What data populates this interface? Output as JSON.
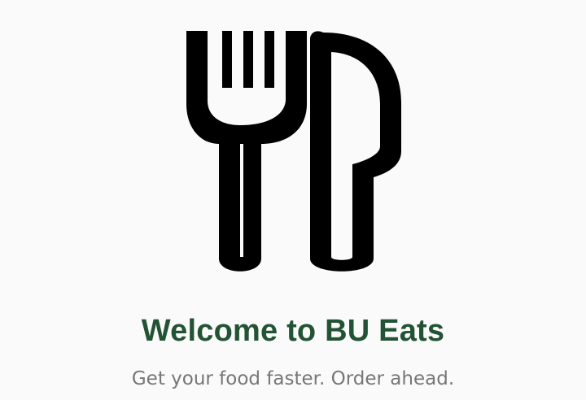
{
  "welcome": {
    "logo_icon": "fork-knife-icon",
    "title": "Welcome to BU Eats",
    "subtitle": "Get your food faster. Order ahead."
  },
  "colors": {
    "brand_green": "#235335",
    "subtitle_gray": "#777777",
    "background": "#fafafa",
    "icon": "#000000"
  }
}
